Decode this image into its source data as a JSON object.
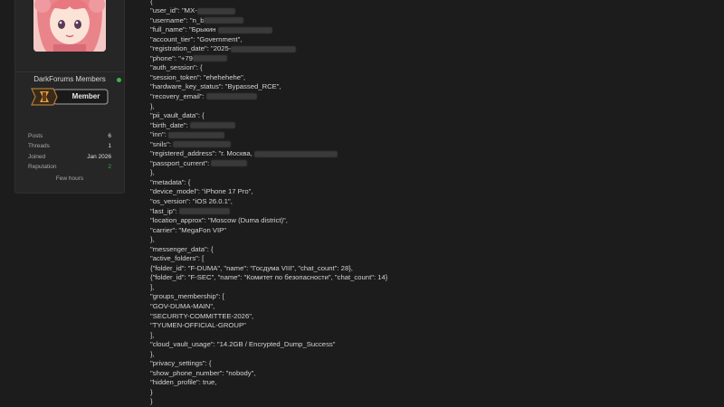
{
  "sidebar": {
    "group_label": "DarkForums Members",
    "badge_label": "Member",
    "stats": [
      {
        "label": "Posts",
        "value": "6"
      },
      {
        "label": "Threads",
        "value": "1"
      },
      {
        "label": "Joined",
        "value": "Jan 2026"
      },
      {
        "label": "Reputation",
        "value": "2"
      }
    ],
    "last_seen": "Few hours",
    "colors": {
      "online": "#3bb34a",
      "reputation": "#3bb34a"
    }
  },
  "code_lines": [
    {
      "text": "{"
    },
    {
      "text": "\"user_id\": \"MX-",
      "blur": 42
    },
    {
      "text": "\"username\": \"n_b",
      "blur": 44
    },
    {
      "text": "\"full_name\": \"Брыкин ",
      "blur": 60
    },
    {
      "text": "\"account_tier\": \"Government\","
    },
    {
      "text": "\"registration_date\": \"2025-",
      "blur": 72
    },
    {
      "text": "\"phone\": \"+79",
      "blur": 38
    },
    {
      "text": "\"auth_session\": {"
    },
    {
      "text": "\"session_token\": \"ehehehehe\","
    },
    {
      "text": "\"hardware_key_status\": \"Bypassed_RCE\","
    },
    {
      "text": "\"recovery_email\": ",
      "blur": 56
    },
    {
      "text": "},"
    },
    {
      "text": "\"pii_vault_data\": {"
    },
    {
      "text": "\"birth_date\": ",
      "blur": 50
    },
    {
      "text": "\"inn\": ",
      "blur": 62
    },
    {
      "text": "\"snils\": ",
      "blur": 64
    },
    {
      "text": "\"registered_address\": \"г. Москва, ",
      "blur": 92
    },
    {
      "text": "\"passport_current\": ",
      "blur": 40
    },
    {
      "text": "},"
    },
    {
      "text": "\"metadata\": {"
    },
    {
      "text": "\"device_model\": \"iPhone 17 Pro\","
    },
    {
      "text": "\"os_version\": \"iOS 26.0.1\","
    },
    {
      "text": "\"last_ip\": ",
      "blur": 56
    },
    {
      "text": "\"location_approx\": \"Moscow (Duma district)\","
    },
    {
      "text": "\"carrier\": \"MegaFon VIP\""
    },
    {
      "text": "},"
    },
    {
      "text": "\"messenger_data\": {"
    },
    {
      "text": "\"active_folders\": ["
    },
    {
      "text": "{\"folder_id\": \"F-DUMA\", \"name\": \"Госдума VIII\", \"chat_count\": 28},"
    },
    {
      "text": "{\"folder_id\": \"F-SEC\", \"name\": \"Комитет по безопасности\", \"chat_count\": 14}"
    },
    {
      "text": "],"
    },
    {
      "text": "\"groups_membership\": ["
    },
    {
      "text": "\"GOV-DUMA-MAIN\","
    },
    {
      "text": "\"SECURITY-COMMITTEE-2026\","
    },
    {
      "text": "\"TYUMEN-OFFICIAL-GROUP\""
    },
    {
      "text": "],"
    },
    {
      "text": "\"cloud_vault_usage\": \"14.2GB / Encrypted_Dump_Success\""
    },
    {
      "text": "},"
    },
    {
      "text": "\"privacy_settings\": {"
    },
    {
      "text": "\"show_phone_number\": \"nobody\","
    },
    {
      "text": "\"hidden_profile\": true,"
    },
    {
      "text": "}"
    },
    {
      "text": "}"
    }
  ]
}
